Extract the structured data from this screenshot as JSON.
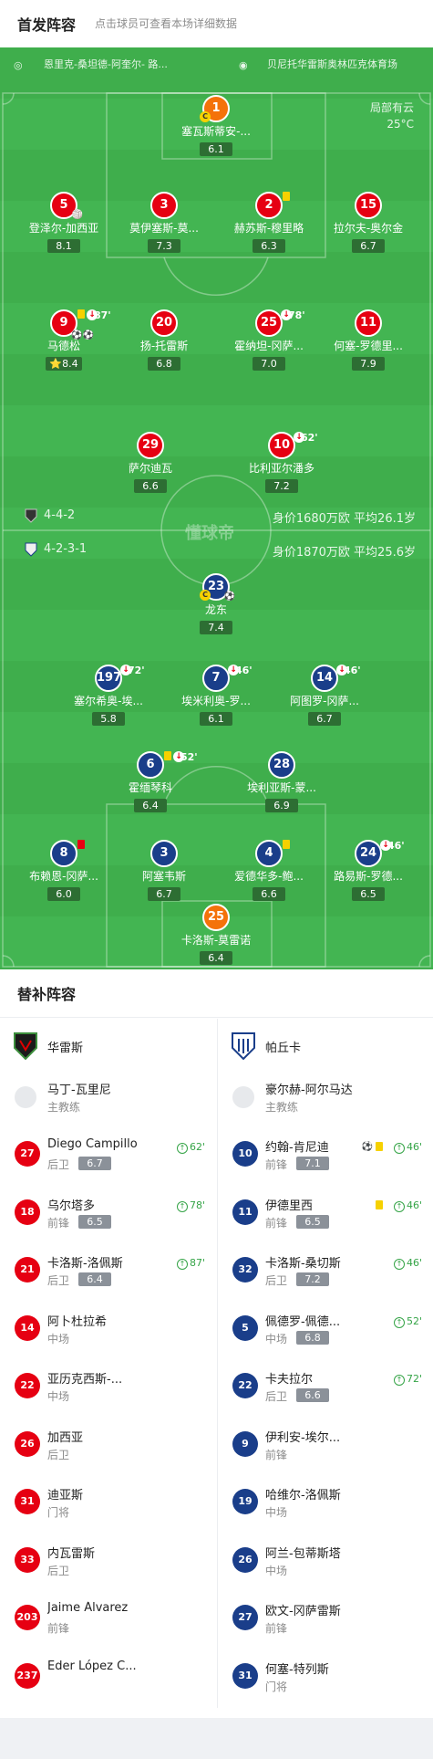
{
  "header": {
    "title": "首发阵容",
    "subtitle": "点击球员可查看本场详细数据"
  },
  "pitch": {
    "home_venue": "恩里克-桑坦德-阿奎尔- 路...",
    "away_venue": "贝尼托华雷斯奥林匹克体育场",
    "weather": "局部有云",
    "temperature": "25°C",
    "watermark": "懂球帝",
    "home_team_formation": "4-4-2",
    "home_team_value": "身价1680万欧 平均26.1岁",
    "away_team_formation": "4-2-3-1",
    "away_team_value": "身价1870万欧 平均25.6岁"
  },
  "home_lineup": [
    {
      "num": "1",
      "name": "塞瓦斯蒂安-...",
      "rating": "6.1"
    },
    {
      "num": "5",
      "name": "登泽尔-加西亚",
      "rating": "8.1"
    },
    {
      "num": "3",
      "name": "莫伊塞斯-莫...",
      "rating": "7.3"
    },
    {
      "num": "2",
      "name": "赫苏斯-穆里略",
      "rating": "6.3"
    },
    {
      "num": "15",
      "name": "拉尔夫-奥尔金",
      "rating": "6.7"
    },
    {
      "num": "9",
      "name": "马德松",
      "rating": "8.4",
      "sub_min": "87'"
    },
    {
      "num": "20",
      "name": "扬-托雷斯",
      "rating": "6.8"
    },
    {
      "num": "25",
      "name": "霍纳坦-冈萨...",
      "rating": "7.0",
      "sub_min": "78'"
    },
    {
      "num": "11",
      "name": "何塞-罗德里...",
      "rating": "7.9"
    },
    {
      "num": "29",
      "name": "萨尔迪瓦",
      "rating": "6.6"
    },
    {
      "num": "10",
      "name": "比利亚尔潘多",
      "rating": "7.2",
      "sub_min": "62'"
    }
  ],
  "away_lineup": [
    {
      "num": "23",
      "name": "龙东",
      "rating": "7.4"
    },
    {
      "num": "197",
      "name": "塞尔希奥-埃...",
      "rating": "5.8",
      "sub_min": "72'"
    },
    {
      "num": "7",
      "name": "埃米利奥-罗...",
      "rating": "6.1",
      "sub_min": "46'"
    },
    {
      "num": "14",
      "name": "阿图罗-冈萨...",
      "rating": "6.7",
      "sub_min": "46'"
    },
    {
      "num": "6",
      "name": "霍缅琴科",
      "rating": "6.4",
      "sub_min": "52'"
    },
    {
      "num": "28",
      "name": "埃利亚斯-蒙...",
      "rating": "6.9"
    },
    {
      "num": "8",
      "name": "布赖恩-冈萨...",
      "rating": "6.0"
    },
    {
      "num": "3",
      "name": "阿塞韦斯",
      "rating": "6.7"
    },
    {
      "num": "4",
      "name": "爱德华多-鲍...",
      "rating": "6.6"
    },
    {
      "num": "24",
      "name": "路易斯-罗德...",
      "rating": "6.5",
      "sub_min": "46'"
    },
    {
      "num": "25",
      "name": "卡洛斯-莫雷诺",
      "rating": "6.4"
    }
  ],
  "bench": {
    "title": "替补阵容",
    "home": {
      "team": "华雷斯",
      "coach": "马丁-瓦里尼",
      "coach_role": "主教练",
      "players": [
        {
          "num": "27",
          "name": "Diego Campillo",
          "pos": "后卫",
          "rating": "6.7",
          "in": "62'"
        },
        {
          "num": "18",
          "name": "乌尔塔多",
          "pos": "前锋",
          "rating": "6.5",
          "in": "78'"
        },
        {
          "num": "21",
          "name": "卡洛斯-洛佩斯",
          "pos": "后卫",
          "rating": "6.4",
          "in": "87'"
        },
        {
          "num": "14",
          "name": "阿卜杜拉希",
          "pos": "中场"
        },
        {
          "num": "22",
          "name": "亚历克西斯-...",
          "pos": "中场"
        },
        {
          "num": "26",
          "name": "加西亚",
          "pos": "后卫"
        },
        {
          "num": "31",
          "name": "迪亚斯",
          "pos": "门将"
        },
        {
          "num": "33",
          "name": "内瓦雷斯",
          "pos": "后卫"
        },
        {
          "num": "203",
          "name": "Jaime Álvarez",
          "pos": "前锋"
        },
        {
          "num": "237",
          "name": "Eder López C...",
          "pos": ""
        }
      ]
    },
    "away": {
      "team": "帕丘卡",
      "coach": "豪尔赫-阿尔马达",
      "coach_role": "主教练",
      "players": [
        {
          "num": "10",
          "name": "约翰-肯尼迪",
          "pos": "前锋",
          "rating": "7.1",
          "in": "46'"
        },
        {
          "num": "11",
          "name": "伊德里西",
          "pos": "前锋",
          "rating": "6.5",
          "in": "46'"
        },
        {
          "num": "32",
          "name": "卡洛斯-桑切斯",
          "pos": "后卫",
          "rating": "7.2",
          "in": "46'"
        },
        {
          "num": "5",
          "name": "佩德罗-佩德...",
          "pos": "中场",
          "rating": "6.8",
          "in": "52'"
        },
        {
          "num": "22",
          "name": "卡夫拉尔",
          "pos": "后卫",
          "rating": "6.6",
          "in": "72'"
        },
        {
          "num": "9",
          "name": "伊利安-埃尔...",
          "pos": "前锋"
        },
        {
          "num": "19",
          "name": "哈维尔-洛佩斯",
          "pos": "中场"
        },
        {
          "num": "26",
          "name": "阿兰-包蒂斯塔",
          "pos": "中场"
        },
        {
          "num": "27",
          "name": "欧文-冈萨雷斯",
          "pos": "前锋"
        },
        {
          "num": "31",
          "name": "何塞-特列斯",
          "pos": "门将"
        }
      ]
    }
  },
  "colors": {
    "home": "#e60012",
    "away": "#1a3e8a",
    "gk": "#f4720a",
    "pitch": "#3fae4c"
  }
}
